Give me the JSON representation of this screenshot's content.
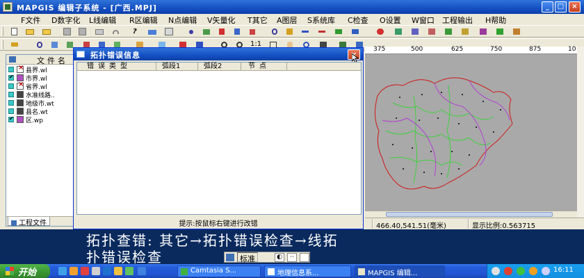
{
  "app": {
    "title": "MAPGIS 编辑子系统 - [广西.MPJ]",
    "window_buttons": {
      "minimize": "_",
      "maximize": "□",
      "close": "×"
    }
  },
  "menu": [
    "F文件",
    "D数字化",
    "L线编辑",
    "R区编辑",
    "N点编辑",
    "V矢量化",
    "T其它",
    "A图层",
    "S系统库",
    "C检查",
    "O设置",
    "W窗口",
    "工程输出",
    "H帮助"
  ],
  "file_panel": {
    "header": "文件名",
    "items": [
      {
        "name": "县界.wl",
        "checked": false,
        "type": "red"
      },
      {
        "name": "市界.wl",
        "checked": true,
        "type": "purple"
      },
      {
        "name": "省界.wl",
        "checked": false,
        "type": "red"
      },
      {
        "name": "水准线路..",
        "checked": false,
        "type": "dark"
      },
      {
        "name": "地级市.wt",
        "checked": false,
        "type": "dark"
      },
      {
        "name": "县名.wt",
        "checked": false,
        "type": "dark"
      },
      {
        "name": "区.wp",
        "checked": true,
        "type": "purple"
      }
    ],
    "tab_label": "工程文件"
  },
  "ruler": {
    "ticks": [
      "375",
      "500",
      "625",
      "750",
      "875",
      "10"
    ]
  },
  "statusbar": {
    "coords": "466.40,541.51(毫米)",
    "scale": "显示比例:0.563715"
  },
  "dialog": {
    "title": "拓扑错误信息",
    "columns": [
      "错误类型",
      "弧段1",
      "弧段2",
      "节点"
    ],
    "hint": "提示:按鼠标右键进行改错",
    "close": "×"
  },
  "subtitle": {
    "line1": "拓扑查错: 其它→拓扑错误检查→线拓",
    "line2": "扑错误检查"
  },
  "ime": {
    "label": "标准",
    "b1": "◐",
    "b2": "··"
  },
  "taskbar": {
    "start_label": "开始",
    "tasks": [
      {
        "label": "Camtasia S...",
        "active": false
      },
      {
        "label": "地理信息系...",
        "active": false
      },
      {
        "label": "MAPGIS 编辑...",
        "active": true
      }
    ],
    "clock": "16:11"
  },
  "colors": {
    "titlebar": "#1450c2",
    "map_bg": "#a9a9a9",
    "boundary_red": "#d01818",
    "boundary_purple": "#b040d0",
    "boundary_green": "#40d040",
    "subtitle_bg": "#0a2a5e"
  }
}
